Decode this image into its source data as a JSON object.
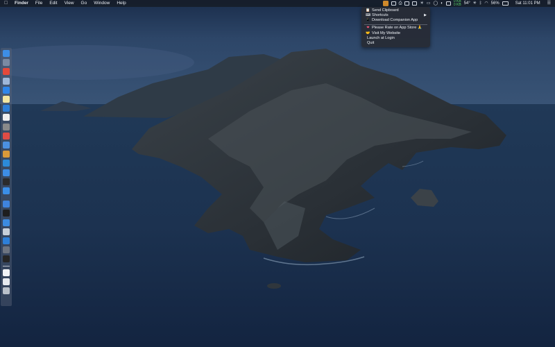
{
  "menubar": {
    "apple_icon": "apple-logo-icon",
    "items": [
      {
        "label": "Finder",
        "app": true
      },
      {
        "label": "File"
      },
      {
        "label": "Edit"
      },
      {
        "label": "View"
      },
      {
        "label": "Go"
      },
      {
        "label": "Window"
      },
      {
        "label": "Help"
      }
    ],
    "status": {
      "network_up": "0 KB",
      "network_down": "0 KB",
      "temperature": "54°",
      "battery": "56%",
      "clock": "Sat 11:01 PM"
    }
  },
  "dropdown": {
    "items": [
      {
        "label": "Send Clipboard",
        "icon": "clipboard-icon"
      },
      {
        "label": "Shortcuts",
        "icon": "shortcuts-icon",
        "submenu": true
      },
      {
        "label": "Download Companion App",
        "icon": "phone-icon"
      }
    ],
    "items2": [
      {
        "label": "Please  Rate on App Store 🙏",
        "icon": "heart-icon"
      },
      {
        "label": "Visit My Website",
        "icon": "handshake-icon"
      },
      {
        "label": "Launch at Login",
        "icon": ""
      },
      {
        "label": "Quit",
        "icon": ""
      }
    ]
  },
  "dock": {
    "apps": [
      {
        "name": "finder-icon",
        "color": "#3d8ee6"
      },
      {
        "name": "launchpad-icon",
        "color": "#7a8aa3"
      },
      {
        "name": "chrome-icon",
        "color": "#e5493a"
      },
      {
        "name": "preview-icon",
        "color": "#9fb7d8"
      },
      {
        "name": "app-store-icon",
        "color": "#2e86ea"
      },
      {
        "name": "notes-icon",
        "color": "#f2e6a0"
      },
      {
        "name": "xcode-icon",
        "color": "#2d7fd8"
      },
      {
        "name": "itunes-icon",
        "color": "#f0f0f0"
      },
      {
        "name": "camera-icon",
        "color": "#8a8a8a"
      },
      {
        "name": "safari-icon",
        "color": "#e04c45"
      },
      {
        "name": "maps-icon",
        "color": "#4b90e2"
      },
      {
        "name": "folder-icon",
        "color": "#d99a3a"
      },
      {
        "name": "vscode-icon",
        "color": "#2c8ad8"
      },
      {
        "name": "copy-icon",
        "color": "#3d8ee6"
      },
      {
        "name": "camera-obscura-icon",
        "color": "#2b2b2b"
      },
      {
        "name": "messages-icon",
        "color": "#3b8fe8"
      }
    ],
    "apps2": [
      {
        "name": "sync-icon",
        "color": "#3f84df"
      },
      {
        "name": "terminal-icon",
        "color": "#1e1e1e"
      },
      {
        "name": "mail-icon",
        "color": "#3c8be0"
      },
      {
        "name": "drive-icon",
        "color": "#c7cfd9"
      },
      {
        "name": "store-icon",
        "color": "#2d7fd8"
      },
      {
        "name": "screen-icon",
        "color": "#6d7480"
      },
      {
        "name": "terminal2-icon",
        "color": "#252525"
      }
    ],
    "docs": [
      {
        "name": "document-icon",
        "color": "#f1f3f6"
      },
      {
        "name": "document2-icon",
        "color": "#e6e9ee"
      },
      {
        "name": "trash-icon",
        "color": "#b9c0c9"
      }
    ]
  }
}
